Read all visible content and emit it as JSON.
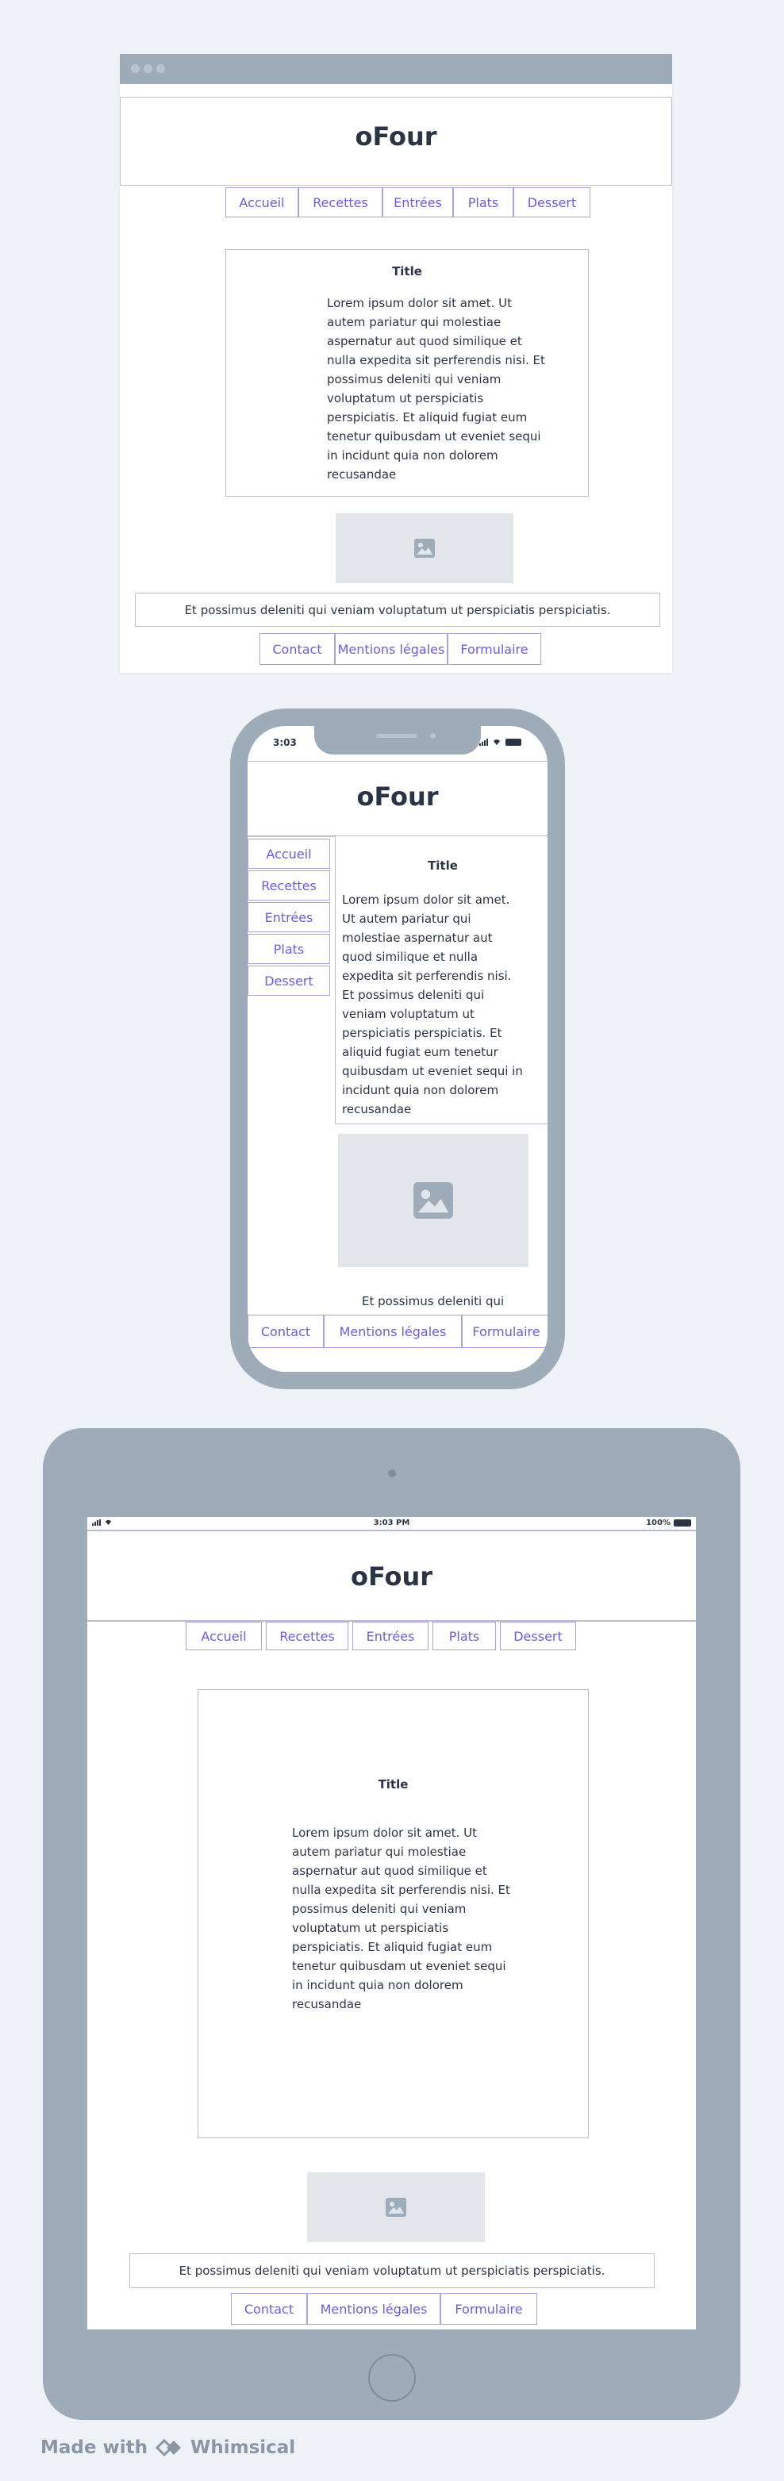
{
  "site": {
    "title": "oFour",
    "nav": [
      "Accueil",
      "Recettes",
      "Entrées",
      "Plats",
      "Dessert"
    ],
    "footer_links": [
      "Contact",
      "Mentions légales",
      "Formulaire"
    ],
    "footer_text": "Et possimus deleniti qui veniam voluptatum ut perspiciatis perspiciatis.",
    "footer_text_phone": "Et possimus deleniti qui",
    "card": {
      "title": "Title",
      "body": "Lorem ipsum dolor sit amet. Ut autem pariatur qui molestiae aspernatur aut quod similique et nulla expedita sit perferendis nisi. Et possimus deleniti qui veniam voluptatum ut perspiciatis perspiciatis. Et aliquid fugiat eum tenetur quibusdam ut eveniet sequi in incidunt quia non dolorem recusandae"
    }
  },
  "phone": {
    "time": "3:03"
  },
  "tablet": {
    "time": "3:03 PM",
    "battery": "100%"
  },
  "branding": {
    "made_with": "Made with",
    "brand": "Whimsical"
  },
  "colors": {
    "frame": "#9eacba",
    "link": "#6b5ce0",
    "border": "#a8a3e0",
    "background": "#eef2f6"
  }
}
